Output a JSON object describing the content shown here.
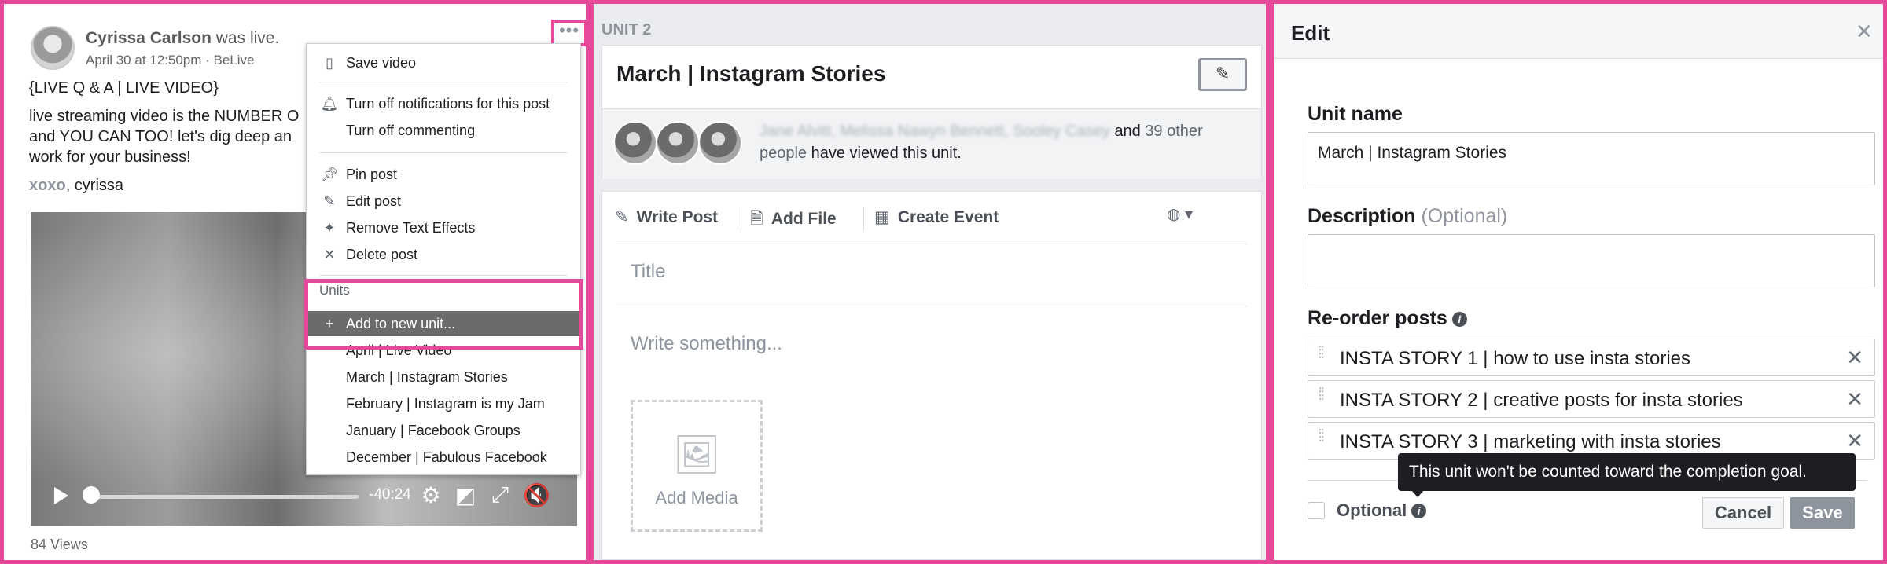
{
  "post": {
    "author": "Cyrissa Carlson",
    "action": "was live.",
    "meta": "April 30 at 12:50pm · BeLive",
    "more_icon": "ellipsis-icon",
    "line1": "{LIVE Q & A | LIVE VIDEO}",
    "line2": "live streaming video is the NUMBER O",
    "line3": "and YOU CAN TOO! let's dig deep an",
    "line4": "work for your business!",
    "sign_xoxo": "xoxo",
    "sign_name": ", cyrissa",
    "video_time": "-40:24",
    "views": "84 Views"
  },
  "post_menu": {
    "items": [
      {
        "label": "Save video",
        "icon": "bookmark-icon"
      },
      {
        "label": "Turn off notifications for this post",
        "icon": "bell-icon"
      },
      {
        "label": "Turn off commenting",
        "icon": ""
      },
      {
        "label": "Pin post",
        "icon": "pin-icon"
      },
      {
        "label": "Edit post",
        "icon": "pencil-icon"
      },
      {
        "label": "Remove Text Effects",
        "icon": "sparkle-icon"
      },
      {
        "label": "Delete post",
        "icon": "x-icon"
      }
    ],
    "units_header": "Units",
    "add_unit": "Add to new unit...",
    "units": [
      "April | Live Video",
      "March | Instagram Stories",
      "February | Instagram is my Jam",
      "January | Facebook Groups",
      "December | Fabulous Facebook"
    ]
  },
  "unit": {
    "label": "UNIT 2",
    "title": "March | Instagram Stories",
    "viewers_names": "Jane Alvitt, Melissa Nawyn Bennett, Sooley Casey",
    "viewers_and": " and ",
    "viewers_count": "39 other people",
    "viewers_suffix": " have viewed this unit."
  },
  "composer": {
    "tabs": [
      "Write Post",
      "Add File",
      "Create Event"
    ],
    "title_placeholder": "Title",
    "body_placeholder": "Write something...",
    "add_media": "Add Media"
  },
  "edit_dialog": {
    "title": "Edit",
    "unit_name_label": "Unit name",
    "unit_name_value": "March | Instagram Stories",
    "description_label": "Description",
    "description_optional": "(Optional)",
    "reorder_label": "Re-order posts",
    "posts": [
      "INSTA STORY 1 | how to use insta stories",
      "INSTA STORY 2 | creative posts for insta stories",
      "INSTA STORY 3 | marketing with insta stories"
    ],
    "tooltip": "This unit won't be counted toward the completion goal.",
    "optional_label": "Optional",
    "cancel": "Cancel",
    "save": "Save"
  },
  "colors": {
    "highlight": "#e6489a",
    "menu_active": "#6b6b6b",
    "tooltip_bg": "#1c1e21"
  }
}
